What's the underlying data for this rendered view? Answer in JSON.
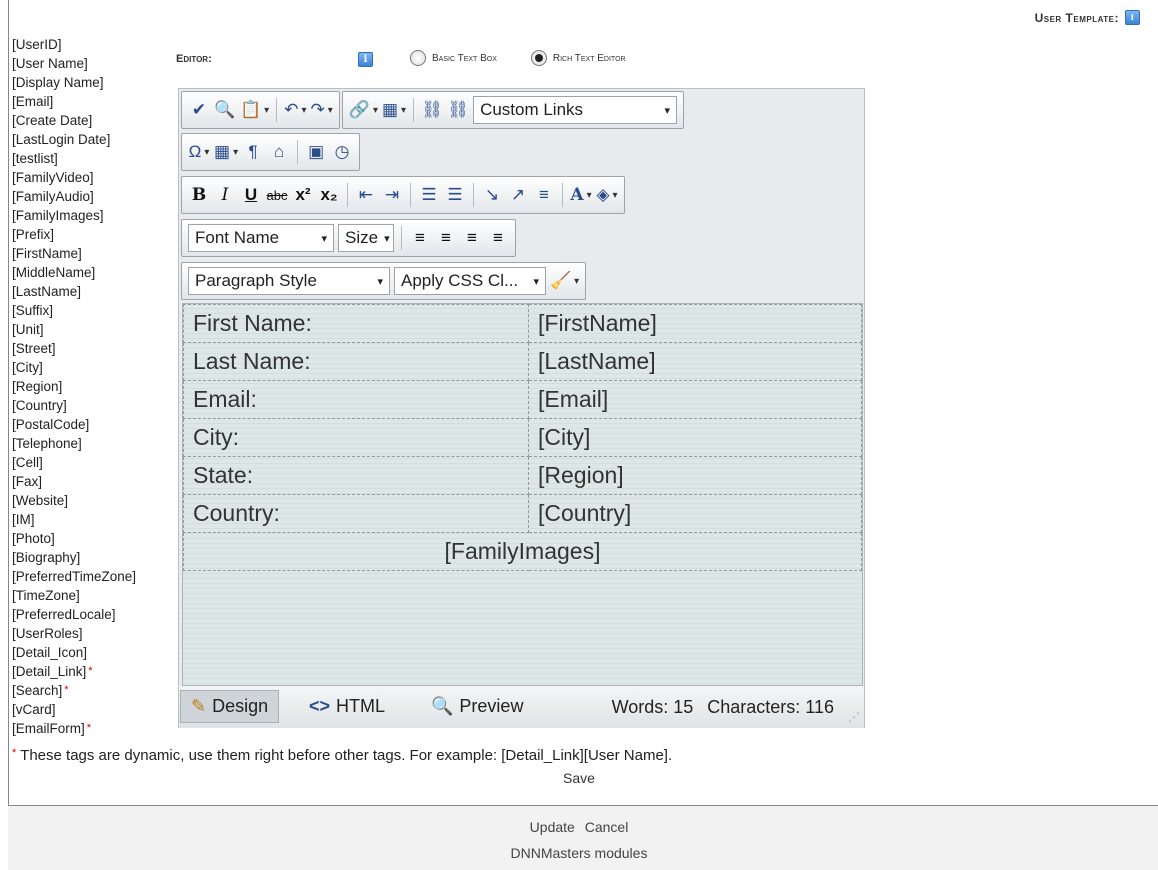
{
  "header": {
    "user_template_label": "User Template:"
  },
  "help_icon_glyph": "i",
  "tokens": [
    {
      "text": "[UserID]",
      "dynamic": false
    },
    {
      "text": "[User Name]",
      "dynamic": false
    },
    {
      "text": "[Display Name]",
      "dynamic": false
    },
    {
      "text": "[Email]",
      "dynamic": false
    },
    {
      "text": "[Create Date]",
      "dynamic": false
    },
    {
      "text": "[LastLogin Date]",
      "dynamic": false
    },
    {
      "text": "[testlist]",
      "dynamic": false
    },
    {
      "text": "[FamilyVideo]",
      "dynamic": false
    },
    {
      "text": "[FamilyAudio]",
      "dynamic": false
    },
    {
      "text": "[FamilyImages]",
      "dynamic": false
    },
    {
      "text": "[Prefix]",
      "dynamic": false
    },
    {
      "text": "[FirstName]",
      "dynamic": false
    },
    {
      "text": "[MiddleName]",
      "dynamic": false
    },
    {
      "text": "[LastName]",
      "dynamic": false
    },
    {
      "text": "[Suffix]",
      "dynamic": false
    },
    {
      "text": "[Unit]",
      "dynamic": false
    },
    {
      "text": "[Street]",
      "dynamic": false
    },
    {
      "text": "[City]",
      "dynamic": false
    },
    {
      "text": "[Region]",
      "dynamic": false
    },
    {
      "text": "[Country]",
      "dynamic": false
    },
    {
      "text": "[PostalCode]",
      "dynamic": false
    },
    {
      "text": "[Telephone]",
      "dynamic": false
    },
    {
      "text": "[Cell]",
      "dynamic": false
    },
    {
      "text": "[Fax]",
      "dynamic": false
    },
    {
      "text": "[Website]",
      "dynamic": false
    },
    {
      "text": "[IM]",
      "dynamic": false
    },
    {
      "text": "[Photo]",
      "dynamic": false
    },
    {
      "text": "[Biography]",
      "dynamic": false
    },
    {
      "text": "[PreferredTimeZone]",
      "dynamic": false
    },
    {
      "text": "[TimeZone]",
      "dynamic": false
    },
    {
      "text": "[PreferredLocale]",
      "dynamic": false
    },
    {
      "text": "[UserRoles]",
      "dynamic": false
    },
    {
      "text": "[Detail_Icon]",
      "dynamic": false
    },
    {
      "text": "[Detail_Link]",
      "dynamic": true
    },
    {
      "text": "[Search]",
      "dynamic": true
    },
    {
      "text": "[vCard]",
      "dynamic": false
    },
    {
      "text": "[EmailForm]",
      "dynamic": true
    }
  ],
  "editor_mode": {
    "label": "Editor:",
    "options": [
      {
        "label": "Basic Text Box",
        "selected": false
      },
      {
        "label": "Rich Text Editor",
        "selected": true
      }
    ]
  },
  "toolbar": {
    "custom_links": "Custom Links",
    "font_name": "Font Name",
    "size": "Size",
    "paragraph_style": "Paragraph Style",
    "apply_css": "Apply CSS Cl...",
    "bold": "B",
    "italic": "I",
    "underline": "U",
    "strike": "abc",
    "superscript": "x²",
    "subscript": "x₂",
    "font_color": "A"
  },
  "content": {
    "rows": [
      {
        "label": "First Name:",
        "value": "[FirstName]"
      },
      {
        "label": "Last Name:",
        "value": "[LastName]"
      },
      {
        "label": "Email:",
        "value": "[Email]"
      },
      {
        "label": "City:",
        "value": "[City]"
      },
      {
        "label": "State:",
        "value": "[Region]"
      },
      {
        "label": "Country:",
        "value": "[Country]"
      }
    ],
    "footer_token": "[FamilyImages]"
  },
  "status_bar": {
    "design": "Design",
    "html": "HTML",
    "preview": "Preview",
    "words": "Words: 15",
    "characters": "Characters: 116",
    "active_mode": "Design"
  },
  "footnote": {
    "star": "*",
    "text": " These tags are dynamic, use them right before other tags. For example: [Detail_Link][User Name]."
  },
  "actions": {
    "save": "Save",
    "update": "Update",
    "cancel": "Cancel"
  },
  "brand": "DNNMasters modules",
  "colors": {
    "accent_icon": "#3b82d6",
    "required_star": "#d10000",
    "content_bg": "#dde8e6"
  }
}
